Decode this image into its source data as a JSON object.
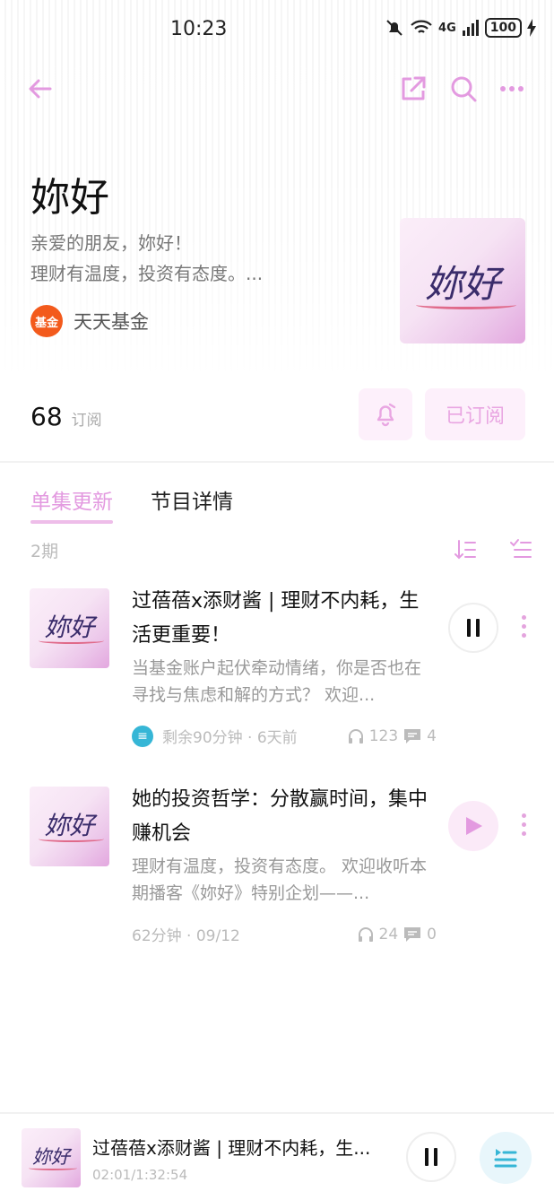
{
  "status_bar": {
    "time": "10:23",
    "signal_label": "4G",
    "battery": "100"
  },
  "podcast": {
    "title": "妳好",
    "description_line1": "亲爱的朋友，妳好！",
    "description_line2": "理财有温度，投资有态度。...",
    "author": "天天基金",
    "author_avatar_text": "基金",
    "cover_text": "妳好",
    "subscriber_count": "68",
    "subscriber_label": "订阅",
    "subscribed_label": "已订阅"
  },
  "tabs": [
    {
      "label": "单集更新",
      "active": true
    },
    {
      "label": "节目详情",
      "active": false
    }
  ],
  "episode_count": "2期",
  "episodes": [
    {
      "title": "过蓓蓓x添财酱 | 理财不内耗，生活更重要！",
      "description": "当基金账户起伏牵动情绪，你是否也在寻找与焦虑和解的方式？ 欢迎...",
      "meta": "剩余90分钟 · 6天前",
      "listens": "123",
      "comments": "4",
      "playing": true,
      "cover_text": "妳好"
    },
    {
      "title": "她的投资哲学：分散赢时间，集中赚机会",
      "description": "理财有温度，投资有态度。 欢迎收听本期播客《妳好》特别企划——...",
      "meta": "62分钟 · 09/12",
      "listens": "24",
      "comments": "0",
      "playing": false,
      "cover_text": "妳好"
    }
  ],
  "player": {
    "title": "过蓓蓓x添财酱 | 理财不内耗，生...",
    "time": "02:01/1:32:54",
    "cover_text": "妳好"
  },
  "colors": {
    "accent": "#e39ae0",
    "accent_soft": "#fdf0fb",
    "played_blue": "#36b6d6"
  }
}
